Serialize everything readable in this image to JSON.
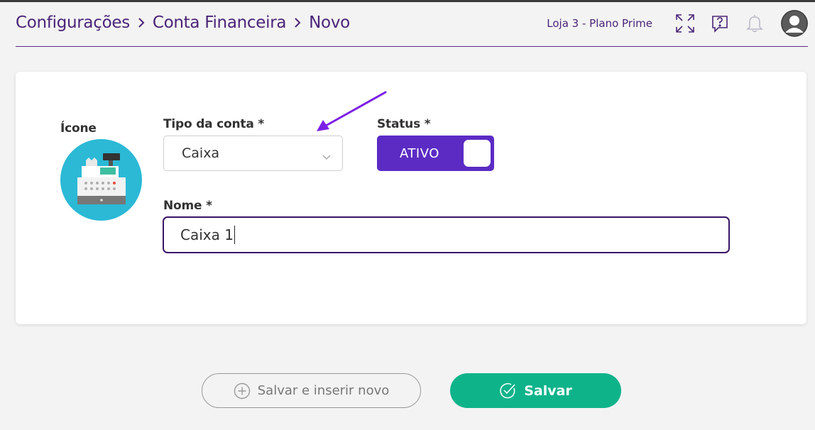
{
  "breadcrumb": {
    "items": [
      "Configurações",
      "Conta Financeira",
      "Novo"
    ]
  },
  "header": {
    "store_label": "Loja 3 - Plano Prime",
    "icons": [
      "expand-icon",
      "help-chat-icon",
      "bell-icon",
      "user-avatar-icon"
    ]
  },
  "form": {
    "icon_label": "Ícone",
    "icon_name": "cash-register-icon",
    "account_type_label": "Tipo da conta *",
    "account_type_value": "Caixa",
    "status_label": "Status *",
    "status_value": "ATIVO",
    "name_label": "Nome *",
    "name_value": "Caixa 1"
  },
  "actions": {
    "save_and_new_label": "Salvar e inserir novo",
    "save_label": "Salvar"
  },
  "colors": {
    "brand_purple": "#5b2bc4",
    "breadcrumb_text": "#4a2478",
    "save_green": "#0fb38a",
    "icon_bg": "#2bb9d6",
    "annotation_arrow": "#7b1fe6"
  }
}
